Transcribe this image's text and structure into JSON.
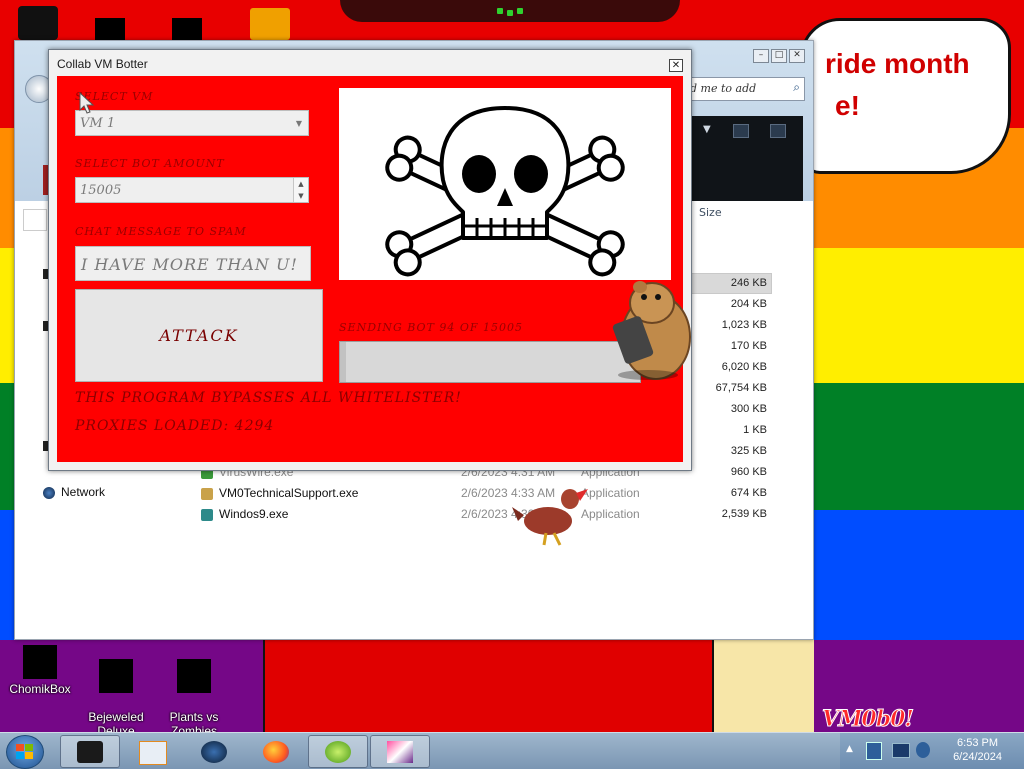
{
  "wallpaper": {
    "speech_bubble": {
      "line1": "ride month",
      "line2": "e!"
    },
    "corner_tag": "VM0b0!"
  },
  "explorer": {
    "search_placeholder": "d me to add",
    "column_size": "Size",
    "sizes": [
      "246 KB",
      "204 KB",
      "1,023 KB",
      "170 KB",
      "6,020 KB",
      "67,754 KB",
      "300 KB",
      "1 KB",
      "325 KB",
      "960 KB",
      "674 KB",
      "2,539 KB"
    ],
    "nav_network": "Network",
    "files": [
      {
        "name": "VirusWire.exe",
        "date": "2/6/2023 4:31 AM",
        "type": "Application",
        "size": "960 KB"
      },
      {
        "name": "VM0TechnicalSupport.exe",
        "date": "2/6/2023 4:33 AM",
        "type": "Application",
        "size": "674 KB"
      },
      {
        "name": "Windos9.exe",
        "date": "2/6/2023 4:30 AM",
        "type": "Application",
        "size": "2,539 KB"
      }
    ]
  },
  "botter": {
    "title": "Collab VM Botter",
    "close_label": "✕",
    "select_vm_label": "SELECT VM",
    "select_vm_value": "VM 1",
    "bot_amount_label": "SELECT BOT AMOUNT",
    "bot_amount_value": "15005",
    "chat_label": "CHAT MESSAGE TO SPAM",
    "chat_value": "I HAVE MORE THAN U!",
    "attack_label": "ATTACK",
    "sending_text": "SENDING BOT 94 OF 15005",
    "progress_fraction": 0.0063,
    "bypass_text": "THIS PROGRAM BYPASSES ALL WHITELISTER!",
    "proxies_text": "PROXIES LOADED: 4294"
  },
  "desktop_icons": [
    {
      "label": "ChomikBox"
    },
    {
      "label": "Bejeweled\nDeluxe"
    },
    {
      "label": "Plants vs\nZombies"
    }
  ],
  "taskbar": {
    "time": "6:53 PM",
    "date": "6/24/2024",
    "tray_expand": "▲"
  }
}
